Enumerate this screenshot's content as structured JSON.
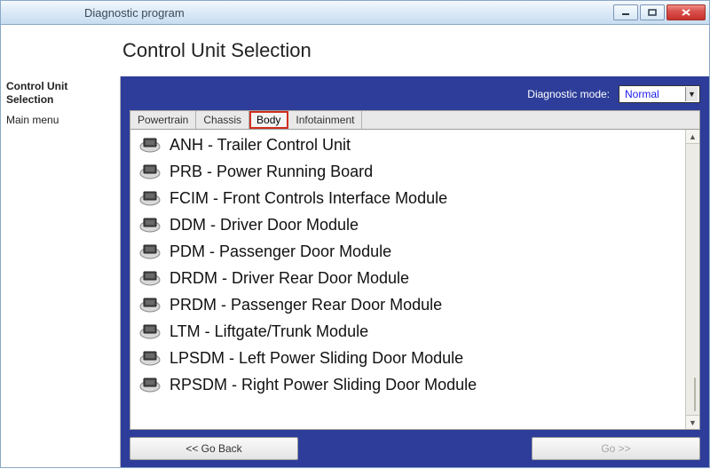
{
  "window": {
    "title": "Diagnostic program"
  },
  "header": {
    "page_title": "Control Unit Selection"
  },
  "sidebar": {
    "title_line1": "Control Unit",
    "title_line2": "Selection",
    "menu_label": "Main menu"
  },
  "diag": {
    "label": "Diagnostic mode:",
    "selected": "Normal"
  },
  "tabs": [
    {
      "label": "Powertrain",
      "active": false
    },
    {
      "label": "Chassis",
      "active": false
    },
    {
      "label": "Body",
      "active": true
    },
    {
      "label": "Infotainment",
      "active": false
    }
  ],
  "modules": [
    {
      "code": "ANH",
      "name": "Trailer Control Unit"
    },
    {
      "code": "PRB",
      "name": "Power Running Board"
    },
    {
      "code": "FCIM",
      "name": "Front Controls Interface Module"
    },
    {
      "code": "DDM",
      "name": "Driver Door Module"
    },
    {
      "code": "PDM",
      "name": "Passenger Door Module"
    },
    {
      "code": "DRDM",
      "name": "Driver Rear Door Module"
    },
    {
      "code": "PRDM",
      "name": "Passenger Rear Door Module"
    },
    {
      "code": "LTM",
      "name": "Liftgate/Trunk Module"
    },
    {
      "code": "LPSDM",
      "name": "Left Power Sliding Door Module"
    },
    {
      "code": "RPSDM",
      "name": "Right Power Sliding Door Module"
    }
  ],
  "buttons": {
    "back": "<< Go Back",
    "go": "Go >>"
  }
}
